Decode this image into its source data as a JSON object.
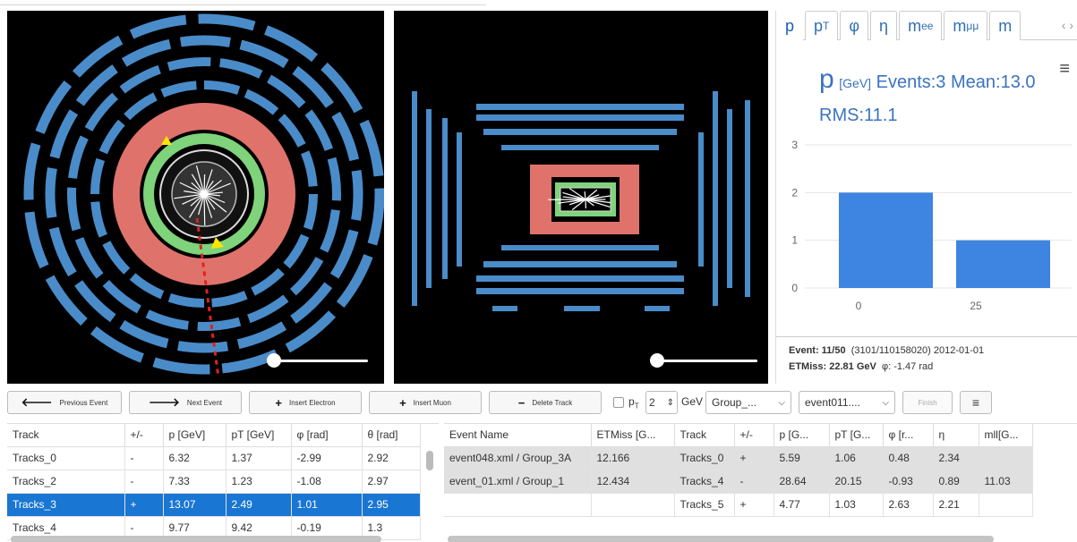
{
  "views": {
    "left": {
      "name": "transverse-view"
    },
    "right": {
      "name": "longitudinal-view"
    }
  },
  "histogram": {
    "tabs": [
      {
        "main": "p",
        "sub": ""
      },
      {
        "main": "p",
        "sub": "T"
      },
      {
        "main": "φ",
        "sub": ""
      },
      {
        "main": "η",
        "sub": ""
      },
      {
        "main": "m",
        "sub": "ee"
      },
      {
        "main": "m",
        "sub": "μμ"
      },
      {
        "main": "m",
        "sub": ""
      }
    ],
    "tab_arrows": "‹ ›",
    "title_symbol": "p",
    "title_unit": "[GeV]",
    "title_stats": "Events:3 Mean:13.0",
    "rms": "RMS:11.1",
    "menu_icon": "≡"
  },
  "chart_data": {
    "type": "bar",
    "categories": [
      "0",
      "25"
    ],
    "values": [
      2,
      1
    ],
    "x_ticks": [
      "0",
      "25"
    ],
    "y_ticks": [
      "0",
      "1",
      "2",
      "3"
    ],
    "ylim": [
      0,
      3
    ],
    "bar_color": "#3d85e0",
    "grid": true
  },
  "event_info": {
    "event": "Event: 11/50",
    "run": "(3101/110158020) 2012-01-01",
    "etmiss": "ETMiss: 22.81 GeV",
    "phi": "φ: -1.47 rad"
  },
  "toolbar": {
    "prev": "Previous Event",
    "next": "Next Event",
    "insert_electron": "Insert Electron",
    "insert_muon": "Insert Muon",
    "delete_track": "Delete Track",
    "pt_label": "p",
    "pt_sub": "T",
    "pt_value": "2",
    "gev": "GeV",
    "group_select": "Group_...",
    "event_select": "event011....",
    "finish": "Finish",
    "menu": "≡"
  },
  "track_table": {
    "headers": [
      "Track",
      "+/-",
      "p [GeV]",
      "pT [GeV]",
      "φ [rad]",
      "θ [rad]"
    ],
    "rows": [
      [
        "Tracks_0",
        "-",
        "6.32",
        "1.37",
        "-2.99",
        "2.92"
      ],
      [
        "Tracks_2",
        "-",
        "7.33",
        "1.23",
        "-1.08",
        "2.97"
      ],
      [
        "Tracks_3",
        "+",
        "13.07",
        "2.49",
        "1.01",
        "2.95"
      ],
      [
        "Tracks_4",
        "-",
        "9.77",
        "9.42",
        "-0.19",
        "1.3"
      ]
    ],
    "selected_row": 2
  },
  "event_table": {
    "headers": [
      "Event Name",
      "ETMiss [G...",
      "Track",
      "+/-",
      "p [G...",
      "pT [G...",
      "φ [r...",
      "η",
      "mll[G..."
    ],
    "rows": [
      [
        "event048.xml / Group_3A",
        "12.166",
        "Tracks_0",
        "+",
        "5.59",
        "1.06",
        "0.48",
        "2.34",
        ""
      ],
      [
        "event_01.xml / Group_1",
        "12.434",
        "Tracks_4",
        "-",
        "28.64",
        "20.15",
        "-0.93",
        "0.89",
        "11.03"
      ],
      [
        "",
        "",
        "Tracks_5",
        "+",
        "4.77",
        "1.03",
        "2.63",
        "2.21",
        ""
      ]
    ]
  }
}
